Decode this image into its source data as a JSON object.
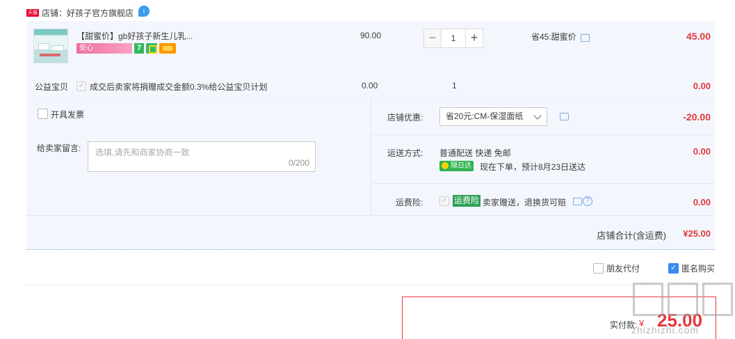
{
  "shop": {
    "badge": "天猫",
    "name": "店铺：好孩子官方旗舰店",
    "chat_badge": "i"
  },
  "item": {
    "title": "【甜蜜价】gb好孩子新生儿乳...",
    "promo_tag": "安心",
    "tag_seven": "7",
    "unit_price": "90.00",
    "quantity": "1",
    "minus": "−",
    "plus": "+",
    "discount": "省45:甜蜜价",
    "subtotal": "45.00"
  },
  "charity": {
    "label": "公益宝贝",
    "check": "✓",
    "text": "成交后卖家将捐赠成交金额0.3%给公益宝贝计划",
    "price": "0.00",
    "qty": "1",
    "subtotal": "0.00"
  },
  "invoice": {
    "label": "开具发票"
  },
  "message": {
    "label": "给卖家留言:",
    "placeholder": "选填,请先和商家协商一致",
    "count": "0/200"
  },
  "shop_coupon": {
    "label": "店铺优惠:",
    "selected": "省20元:CM-保湿面纸",
    "amount": "-20.00"
  },
  "shipping": {
    "label": "运送方式:",
    "method": "普通配送 快递 免邮",
    "nextday_badge": "隔日达",
    "eta": "现在下单，预计8月23日送达",
    "amount": "0.00"
  },
  "insurance": {
    "label": "运费险:",
    "check": "✓",
    "badge": "运费险",
    "text": "卖家赠送，退换货可赔",
    "help": "?",
    "amount": "0.00"
  },
  "shop_total": {
    "label": "店铺合计(含运费)",
    "value": "¥25.00"
  },
  "options": {
    "friend_pay": "朋友代付",
    "anonymous": "匿名购买",
    "anonymous_check": "✓"
  },
  "payment": {
    "label": "实付款:",
    "symbol": "¥",
    "amount": "25.00"
  },
  "watermark": {
    "text": "zhizhizhi.com"
  },
  "colors": {
    "accent_red": "#e4393c",
    "panel_bg": "#f3f6fd",
    "check_blue": "#3a88f0",
    "badge_green": "#2fb34f"
  }
}
